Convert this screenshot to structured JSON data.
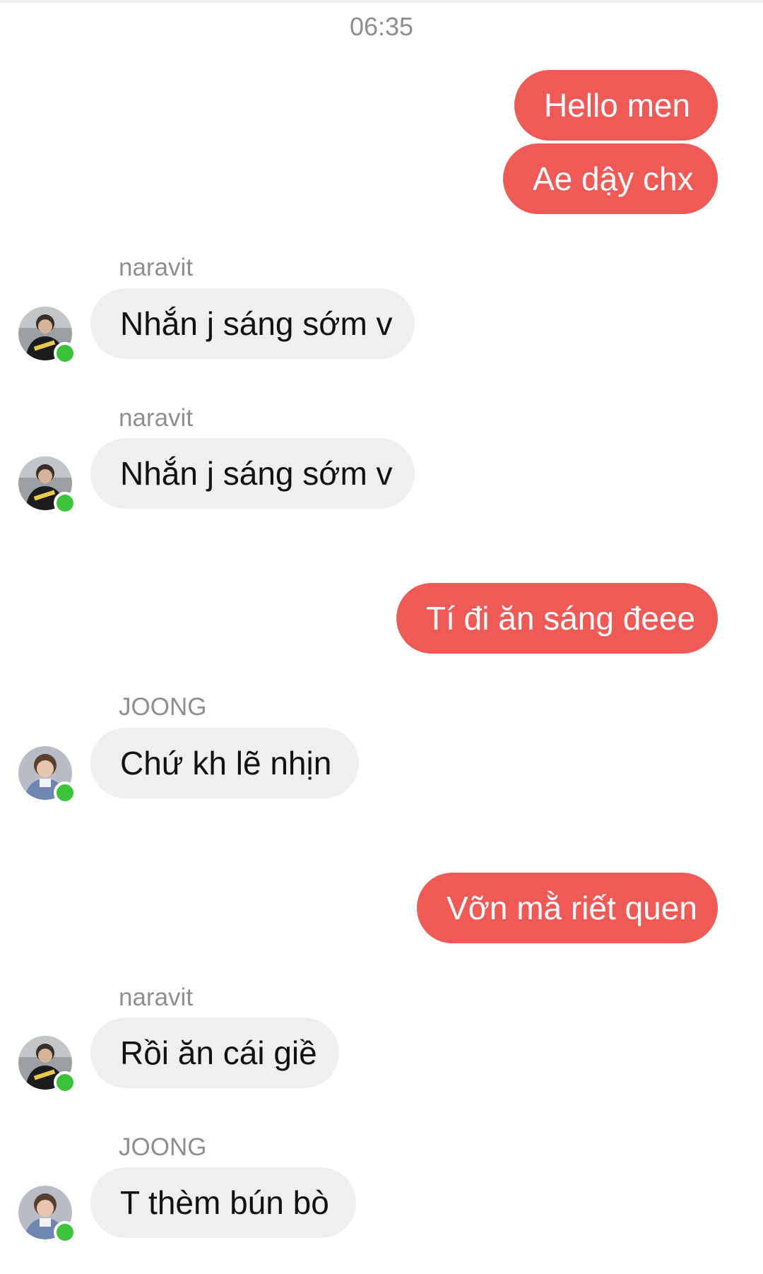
{
  "chat": {
    "timestamp": "06:35",
    "status_colors": {
      "outgoing_bubble": "#f05a56",
      "incoming_bubble": "#efefef",
      "online": "#3cc33c"
    },
    "messages": [
      {
        "direction": "out",
        "text": "Hello men"
      },
      {
        "direction": "out",
        "text": "Ae dậy chx"
      },
      {
        "direction": "in",
        "sender": "naravit",
        "avatar": "avatar-naravit",
        "text": "Nhắn j sáng sớm v"
      },
      {
        "direction": "in",
        "sender": "naravit",
        "avatar": "avatar-naravit",
        "text": "Nhắn j sáng sớm v"
      },
      {
        "direction": "out",
        "text": "Tí đi ăn sáng đeee"
      },
      {
        "direction": "in",
        "sender": "JOONG",
        "avatar": "avatar-joong",
        "text": "Chứ kh lẽ nhịn"
      },
      {
        "direction": "out",
        "text": "Vỡn mằ riết quen"
      },
      {
        "direction": "in",
        "sender": "naravit",
        "avatar": "avatar-naravit",
        "text": "Rồi ăn cái giề"
      },
      {
        "direction": "in",
        "sender": "JOONG",
        "avatar": "avatar-joong",
        "text": "T thèm bún bò"
      }
    ]
  }
}
